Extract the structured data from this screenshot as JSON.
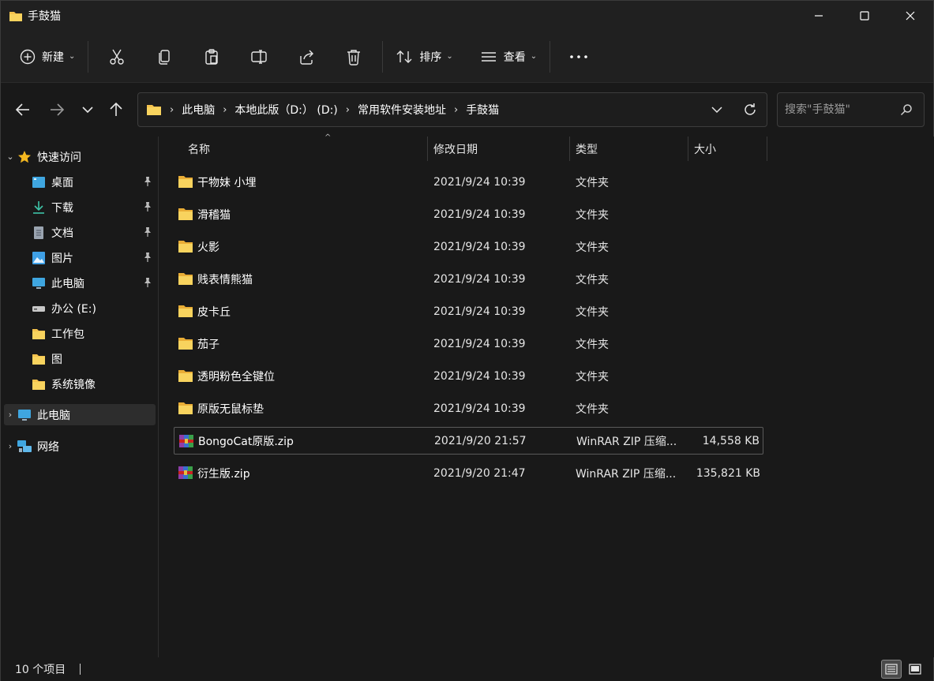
{
  "window": {
    "title": "手鼓猫"
  },
  "toolbar": {
    "new_label": "新建",
    "sort_label": "排序",
    "view_label": "查看"
  },
  "address": {
    "crumbs": [
      "此电脑",
      "本地此版（D:） (D:)",
      "常用软件安装地址",
      "手鼓猫"
    ]
  },
  "search": {
    "placeholder": "搜索\"手鼓猫\""
  },
  "sidebar": {
    "quick_access": "快速访问",
    "items": [
      {
        "label": "桌面"
      },
      {
        "label": "下载"
      },
      {
        "label": "文档"
      },
      {
        "label": "图片"
      },
      {
        "label": "此电脑"
      },
      {
        "label": "办公 (E:)"
      },
      {
        "label": "工作包"
      },
      {
        "label": "图"
      },
      {
        "label": "系统镜像"
      }
    ],
    "this_pc": "此电脑",
    "network": "网络"
  },
  "columns": {
    "name": "名称",
    "date": "修改日期",
    "type": "类型",
    "size": "大小"
  },
  "files": [
    {
      "name": "干物妹 小埋",
      "date": "2021/9/24 10:39",
      "type": "文件夹",
      "size": ""
    },
    {
      "name": "滑稽猫",
      "date": "2021/9/24 10:39",
      "type": "文件夹",
      "size": ""
    },
    {
      "name": "火影",
      "date": "2021/9/24 10:39",
      "type": "文件夹",
      "size": ""
    },
    {
      "name": "贱表情熊猫",
      "date": "2021/9/24 10:39",
      "type": "文件夹",
      "size": ""
    },
    {
      "name": "皮卡丘",
      "date": "2021/9/24 10:39",
      "type": "文件夹",
      "size": ""
    },
    {
      "name": "茄子",
      "date": "2021/9/24 10:39",
      "type": "文件夹",
      "size": ""
    },
    {
      "name": "透明粉色全键位",
      "date": "2021/9/24 10:39",
      "type": "文件夹",
      "size": ""
    },
    {
      "name": "原版无鼠标垫",
      "date": "2021/9/24 10:39",
      "type": "文件夹",
      "size": ""
    },
    {
      "name": "BongoCat原版.zip",
      "date": "2021/9/20 21:57",
      "type": "WinRAR ZIP 压缩...",
      "size": "14,558 KB"
    },
    {
      "name": "衍生版.zip",
      "date": "2021/9/20 21:47",
      "type": "WinRAR ZIP 压缩...",
      "size": "135,821 KB"
    }
  ],
  "status": {
    "count": "10 个项目"
  },
  "colors": {
    "folder": "#f4c24d",
    "background": "#191919",
    "chrome": "#202020"
  }
}
